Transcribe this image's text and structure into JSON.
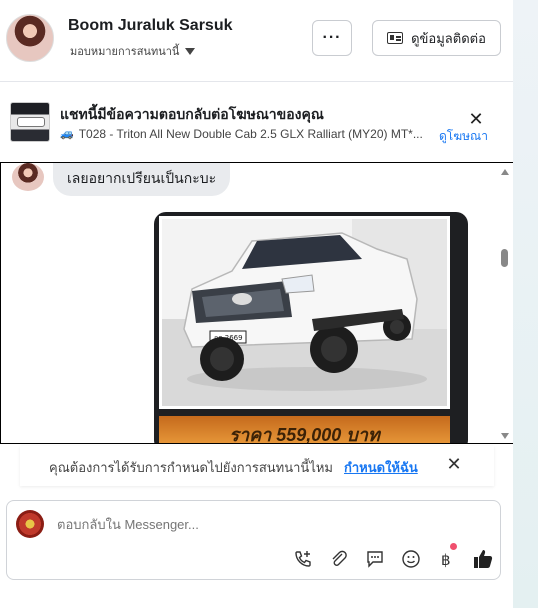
{
  "header": {
    "name": "Boom Juraluk Sarsuk",
    "assign_label": "มอบหมายการสนทนานี้",
    "more_label": "···",
    "contact_label": "ดูข้อมูลติดต่อ"
  },
  "ad_reply": {
    "title": "แชทนี้มีข้อความตอบกลับต่อโฆษณาของคุณ",
    "subtitle": "T028 - Triton All New Double Cab 2.5 GLX Ralliart (MY20) MT*...",
    "view_ad_label": "ดูโฆษณา",
    "close_label": "✕"
  },
  "messages": [
    {
      "direction": "incoming",
      "text": "เลยอยากเปรียนเป็นกะบะ"
    }
  ],
  "photo_card": {
    "price_text": "ราคา 559,000 บาท",
    "plate_text": "กธ 2669"
  },
  "notice": {
    "text": "คุณต้องการได้รับการกำหนดไปยังการสนทนานี้ไหม",
    "link_label": "กำหนดให้ฉัน",
    "close_label": "✕"
  },
  "composer": {
    "placeholder": "ตอบกลับใน Messenger..."
  },
  "colors": {
    "accent": "#1877f2",
    "notification_dot": "#f0506e",
    "price_bar": "#f0a341"
  }
}
